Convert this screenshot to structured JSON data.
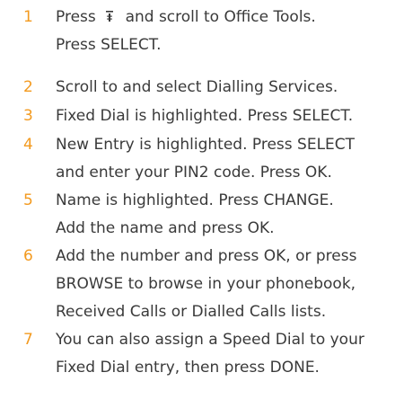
{
  "steps": [
    {
      "number": "1",
      "lines": [
        "Press",
        "and scroll to Office Tools.",
        "Press SELECT."
      ],
      "icon": "menu-icon"
    },
    {
      "number": "2",
      "lines": [
        "Scroll to and select Dialling Services."
      ]
    },
    {
      "number": "3",
      "lines": [
        "Fixed Dial is highlighted. Press SELECT."
      ]
    },
    {
      "number": "4",
      "lines": [
        "New Entry is highlighted. Press SELECT",
        "and enter your PIN2 code. Press OK."
      ]
    },
    {
      "number": "5",
      "lines": [
        "Name is highlighted. Press CHANGE.",
        "Add the name and press OK."
      ]
    },
    {
      "number": "6",
      "lines": [
        "Add the number and press OK, or press",
        "BROWSE to browse in your phonebook,",
        "Received Calls or Dialled Calls lists."
      ]
    },
    {
      "number": "7",
      "lines": [
        "You can also assign a Speed Dial to your",
        "Fixed Dial entry, then press DONE."
      ]
    }
  ],
  "colors": {
    "number": "#f39a1f",
    "text": "#3a3a3a"
  }
}
